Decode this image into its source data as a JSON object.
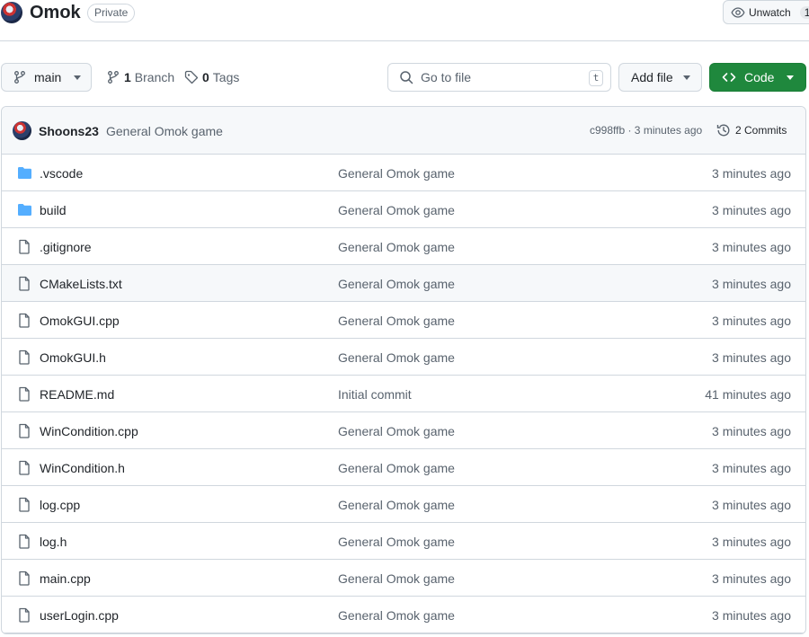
{
  "repo": {
    "name": "Omok",
    "visibility": "Private",
    "watch_label": "Unwatch",
    "watch_count": "1"
  },
  "toolbar": {
    "branch": "main",
    "branch_count": "1",
    "branch_label": "Branch",
    "tag_count": "0",
    "tag_label": "Tags",
    "search_placeholder": "Go to file",
    "search_shortcut": "t",
    "add_file_label": "Add file",
    "code_label": "Code",
    "code_color": "#1f883d"
  },
  "latest_commit": {
    "author": "Shoons23",
    "message": "General Omok game",
    "meta": "c998ffb · 3 minutes ago",
    "commits_label": "2 Commits"
  },
  "files": [
    {
      "name": ".vscode",
      "type": "folder",
      "message": "General Omok game",
      "time": "3 minutes ago"
    },
    {
      "name": "build",
      "type": "folder",
      "message": "General Omok game",
      "time": "3 minutes ago"
    },
    {
      "name": ".gitignore",
      "type": "file",
      "message": "General Omok game",
      "time": "3 minutes ago"
    },
    {
      "name": "CMakeLists.txt",
      "type": "file",
      "message": "General Omok game",
      "time": "3 minutes ago"
    },
    {
      "name": "OmokGUI.cpp",
      "type": "file",
      "message": "General Omok game",
      "time": "3 minutes ago"
    },
    {
      "name": "OmokGUI.h",
      "type": "file",
      "message": "General Omok game",
      "time": "3 minutes ago"
    },
    {
      "name": "README.md",
      "type": "file",
      "message": "Initial commit",
      "time": "41 minutes ago"
    },
    {
      "name": "WinCondition.cpp",
      "type": "file",
      "message": "General Omok game",
      "time": "3 minutes ago"
    },
    {
      "name": "WinCondition.h",
      "type": "file",
      "message": "General Omok game",
      "time": "3 minutes ago"
    },
    {
      "name": "log.cpp",
      "type": "file",
      "message": "General Omok game",
      "time": "3 minutes ago"
    },
    {
      "name": "log.h",
      "type": "file",
      "message": "General Omok game",
      "time": "3 minutes ago"
    },
    {
      "name": "main.cpp",
      "type": "file",
      "message": "General Omok game",
      "time": "3 minutes ago"
    },
    {
      "name": "userLogin.cpp",
      "type": "file",
      "message": "General Omok game",
      "time": "3 minutes ago"
    }
  ],
  "colors": {
    "folder": "#54aeff",
    "file_icon": "#59636e",
    "border": "#d0d7de"
  }
}
